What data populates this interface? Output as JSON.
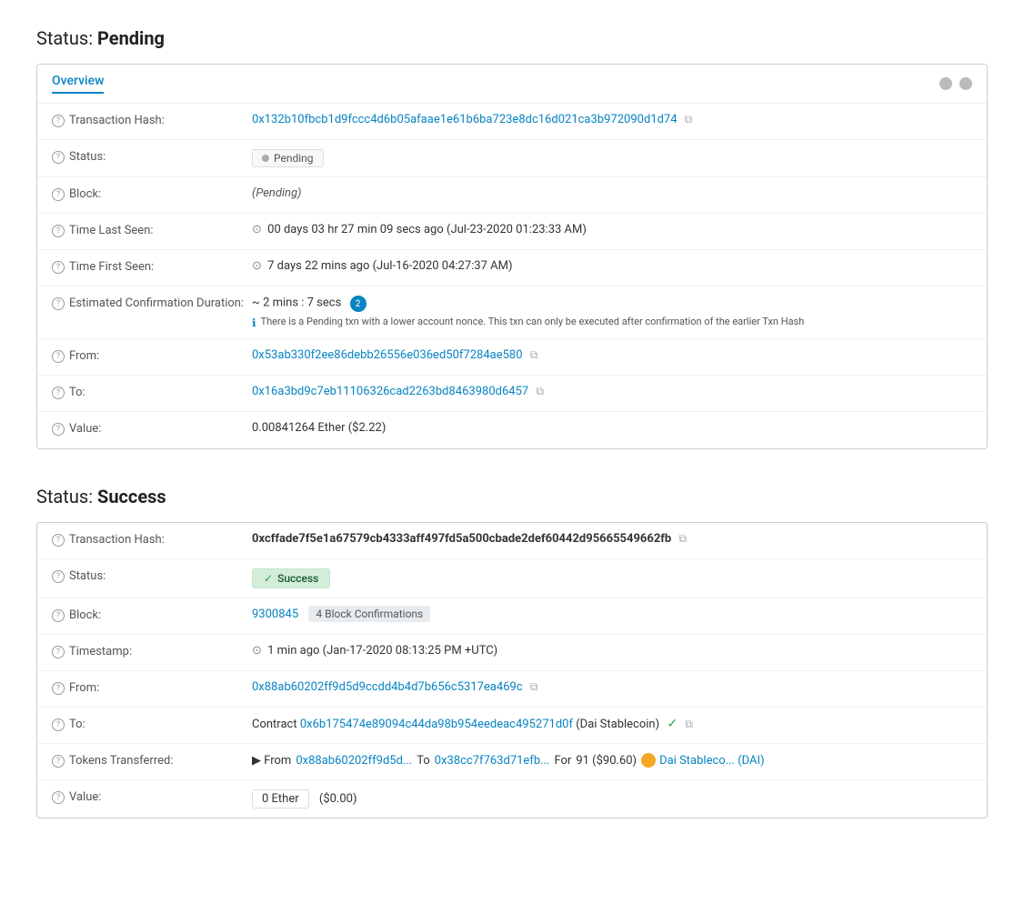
{
  "pending": {
    "section_title": "Status: ",
    "section_title_bold": "Pending",
    "tab_label": "Overview",
    "transaction_hash_label": "Transaction Hash:",
    "transaction_hash_value": "0x132b10fbcb1d9fccc4d6b05afaae1e61b6ba723e8dc16d021ca3b972090d1d74",
    "status_label": "Status:",
    "status_value": "Pending",
    "block_label": "Block:",
    "block_value": "(Pending)",
    "time_last_seen_label": "Time Last Seen:",
    "time_last_seen_value": "00 days 03 hr 27 min 09 secs ago (Jul-23-2020 01:23:33 AM)",
    "time_first_seen_label": "Time First Seen:",
    "time_first_seen_value": "7 days 22 mins ago (Jul-16-2020 04:27:37 AM)",
    "est_confirm_label": "Estimated Confirmation Duration:",
    "est_confirm_value": "~ 2 mins : 7 secs",
    "est_confirm_note": "There is a Pending txn with a lower account nonce. This txn can only be executed after confirmation of the earlier Txn Hash",
    "from_label": "From:",
    "from_value": "0x53ab330f2ee86debb26556e036ed50f7284ae580",
    "to_label": "To:",
    "to_value": "0x16a3bd9c7eb11106326cad2263bd8463980d6457",
    "value_label": "Value:",
    "value_value": "0.00841264 Ether ($2.22)"
  },
  "success": {
    "section_title": "Status: ",
    "section_title_bold": "Success",
    "transaction_hash_label": "Transaction Hash:",
    "transaction_hash_value": "0xcffade7f5e1a67579cb4333aff497fd5a500cbade2def60442d95665549662fb",
    "status_label": "Status:",
    "status_value": "Success",
    "block_label": "Block:",
    "block_number": "9300845",
    "block_confirmations": "4 Block Confirmations",
    "timestamp_label": "Timestamp:",
    "timestamp_value": "1 min ago (Jan-17-2020 08:13:25 PM +UTC)",
    "from_label": "From:",
    "from_value": "0x88ab60202ff9d5d9ccdd4b4d7b656c5317ea469c",
    "to_label": "To:",
    "to_prefix": "Contract",
    "to_contract_value": "0x6b175474e89094c44da98b954eedeac495271d0f",
    "to_contract_name": "(Dai Stablecoin)",
    "tokens_label": "Tokens Transferred:",
    "tokens_from_prefix": "▶ From",
    "tokens_from_value": "0x88ab60202ff9d5d...",
    "tokens_to_prefix": "To",
    "tokens_to_value": "0x38cc7f763d71efb...",
    "tokens_for_prefix": "For",
    "tokens_amount": "91 ($90.60)",
    "tokens_dai_label": "Dai Stableco... (DAI)",
    "value_label": "Value:",
    "value_box": "0 Ether",
    "value_usd": "($0.00)"
  },
  "icons": {
    "help": "?",
    "copy": "⧉",
    "clock": "⊙",
    "check": "✓",
    "info": "ℹ"
  }
}
